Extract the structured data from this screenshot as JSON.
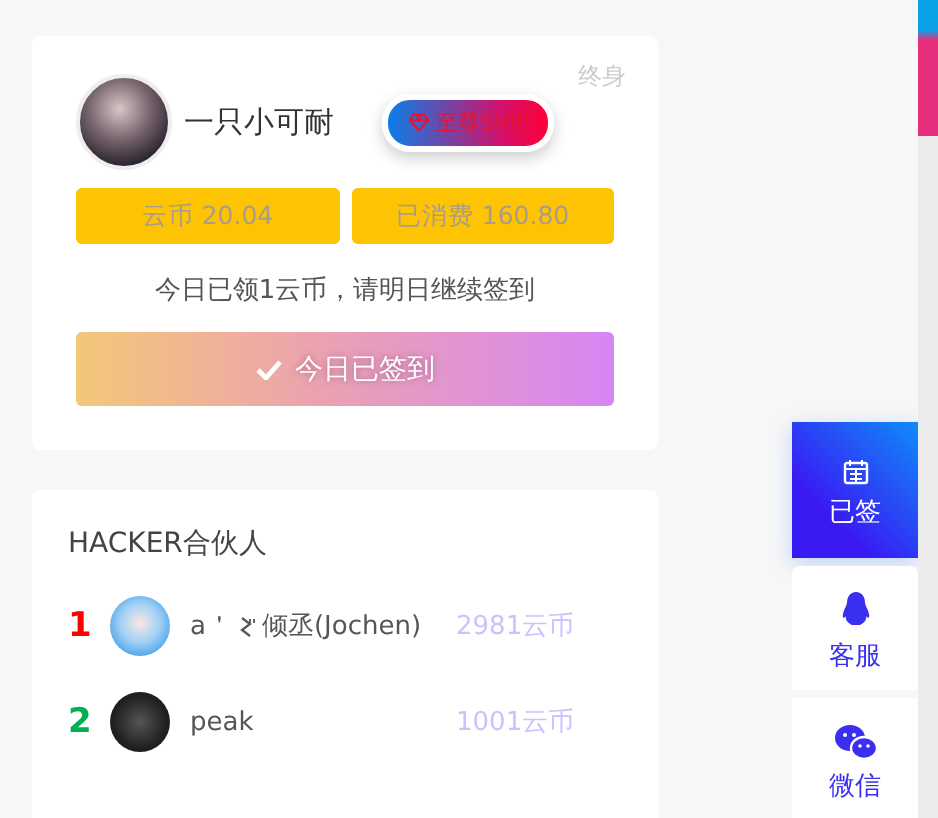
{
  "profile": {
    "corner_label": "终身",
    "username": "一只小可耐",
    "badge": "至尊SVIP",
    "stats": [
      "云币 20.04",
      "已消费 160.80"
    ],
    "message": "今日已领1云币，请明日继续签到",
    "checkin_button": {
      "label": "今日已签到",
      "checked": true
    }
  },
  "partners": {
    "title": "HACKER合伙人",
    "rows": [
      {
        "rank": "1",
        "color": "#ff0000",
        "name_prefix": "a＇",
        "name": "倾丞(Jochen)",
        "coins": "2981云币"
      },
      {
        "rank": "2",
        "color": "#00b050",
        "name": "peak",
        "coins": "1001云币"
      }
    ]
  },
  "sidebar": [
    {
      "kind": "calendar",
      "label": "已签",
      "selected": true
    },
    {
      "kind": "qq",
      "label": "客服",
      "selected": false
    },
    {
      "kind": "wechat",
      "label": "微信",
      "selected": false
    }
  ]
}
